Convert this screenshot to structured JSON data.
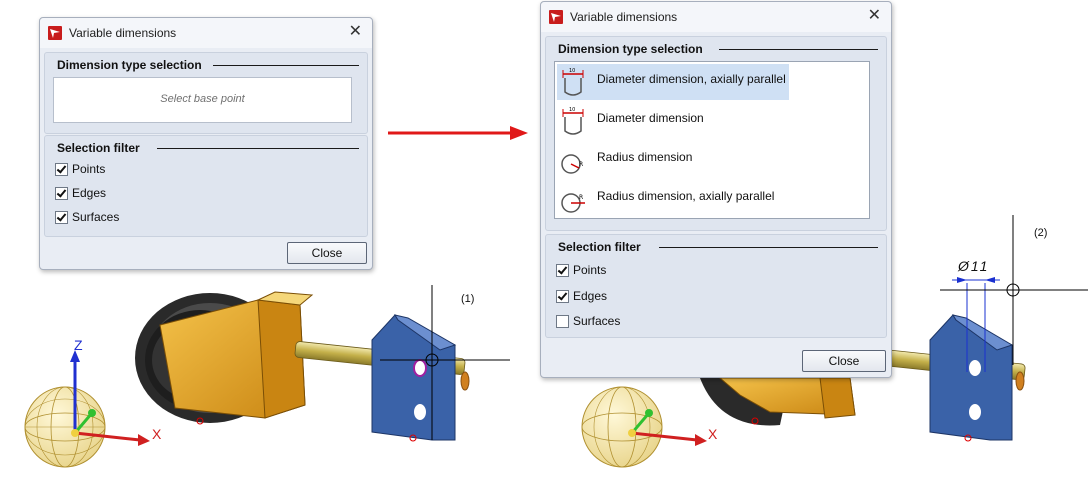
{
  "left_dialog": {
    "title": "Variable dimensions",
    "dim_section": "Dimension type selection",
    "prompt": "Select base point",
    "filter_section": "Selection filter",
    "filters": [
      {
        "label": "Points",
        "checked": true
      },
      {
        "label": "Edges",
        "checked": true
      },
      {
        "label": "Surfaces",
        "checked": true
      }
    ],
    "close_label": "Close"
  },
  "right_dialog": {
    "title": "Variable dimensions",
    "dim_section": "Dimension type selection",
    "dimension_types": [
      {
        "label": "Diameter dimension, axially parallel",
        "icon": "diameter-axial-icon",
        "selected": true
      },
      {
        "label": "Diameter dimension",
        "icon": "diameter-icon",
        "selected": false
      },
      {
        "label": "Radius dimension",
        "icon": "radius-icon",
        "selected": false
      },
      {
        "label": "Radius dimension, axially parallel",
        "icon": "radius-axial-icon",
        "selected": false
      }
    ],
    "filter_section": "Selection filter",
    "filters": [
      {
        "label": "Points",
        "checked": true
      },
      {
        "label": "Edges",
        "checked": true
      },
      {
        "label": "Surfaces",
        "checked": false
      }
    ],
    "close_label": "Close"
  },
  "annotations": {
    "step1": "(1)",
    "step2": "(2)",
    "dimension_value": "Ø11",
    "axis_x": "X",
    "axis_z": "Z"
  },
  "colors": {
    "arrow": "#e01818",
    "part_orange": "#e0a020",
    "bracket_blue": "#3a62a8",
    "selection_highlight": "#cfe0f4"
  }
}
